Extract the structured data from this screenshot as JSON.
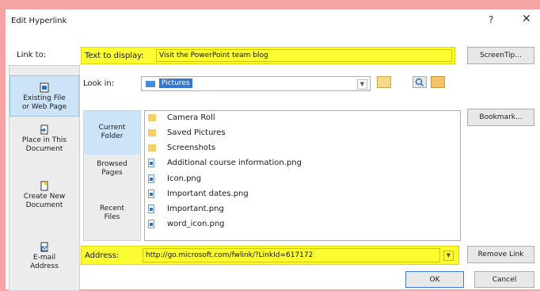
{
  "dialog": {
    "title": "Edit Hyperlink",
    "help_glyph": "?",
    "close_glyph": "✕"
  },
  "link_to": {
    "label": "Link to:",
    "items": [
      {
        "line1": "Existing File",
        "line2": "or Web Page",
        "icon": "existing-file-icon",
        "active": true
      },
      {
        "line1": "Place in This",
        "line2": "Document",
        "icon": "place-in-document-icon",
        "active": false
      },
      {
        "line1": "Create New",
        "line2": "Document",
        "icon": "new-document-icon",
        "active": false
      },
      {
        "line1": "E-mail",
        "line2": "Address",
        "icon": "email-icon",
        "active": false
      }
    ]
  },
  "text_to_display": {
    "label": "Text to display:",
    "value": "Visit the PowerPoint team blog"
  },
  "screentip_button": "ScreenTip...",
  "look_in": {
    "label": "Look in:",
    "value": "Pictures"
  },
  "side_tabs": [
    {
      "line1": "Current",
      "line2": "Folder",
      "active": true
    },
    {
      "line1": "Browsed",
      "line2": "Pages",
      "active": false
    },
    {
      "line1": "Recent",
      "line2": "Files",
      "active": false
    }
  ],
  "files": [
    {
      "name": "Camera Roll",
      "type": "folder"
    },
    {
      "name": "Saved Pictures",
      "type": "folder"
    },
    {
      "name": "Screenshots",
      "type": "folder"
    },
    {
      "name": "Additional course information.png",
      "type": "png"
    },
    {
      "name": "Icon.png",
      "type": "png"
    },
    {
      "name": "Important dates.png",
      "type": "png"
    },
    {
      "name": "Important.png",
      "type": "png"
    },
    {
      "name": "word_icon.png",
      "type": "png"
    }
  ],
  "bookmark_button": "Bookmark...",
  "address": {
    "label": "Address:",
    "value": "http://go.microsoft.com/fwlink/?LinkId=617172"
  },
  "remove_link_button": "Remove Link",
  "ok_button": "OK",
  "cancel_button": "Cancel",
  "colors": {
    "highlight": "#fcfc33",
    "selection": "#3478d4",
    "active_tab": "#cde3f7",
    "background": "#f6a3a3"
  }
}
